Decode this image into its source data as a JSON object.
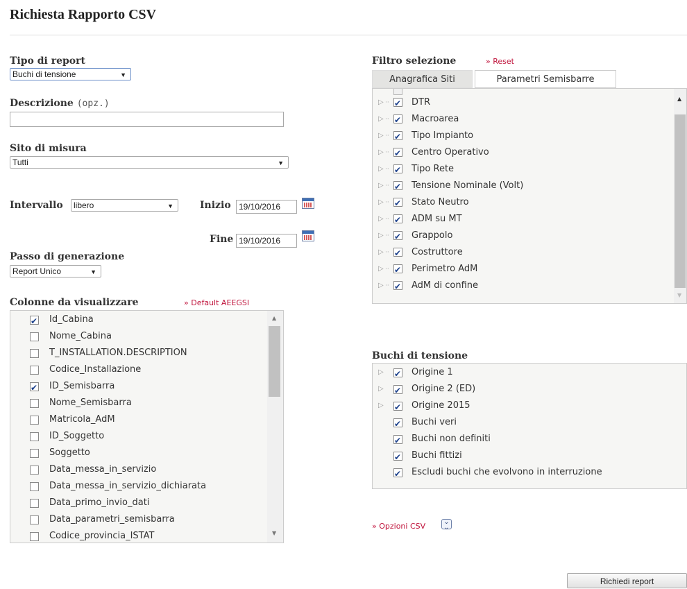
{
  "page": {
    "title": "Richiesta Rapporto CSV"
  },
  "form": {
    "tipo_report": {
      "label": "Tipo di report",
      "value": "Buchi di tensione"
    },
    "descrizione": {
      "label": "Descrizione",
      "optional": "(opz.)",
      "value": ""
    },
    "sito": {
      "label": "Sito di misura",
      "value": "Tutti"
    },
    "intervallo": {
      "label": "Intervallo",
      "value": "libero"
    },
    "inizio": {
      "label": "Inizio",
      "value": "19/10/2016"
    },
    "fine": {
      "label": "Fine",
      "value": "19/10/2016"
    },
    "passo": {
      "label": "Passo di generazione",
      "value": "Report Unico"
    }
  },
  "colonne": {
    "label": "Colonne da visualizzare",
    "default_link": "» Default AEEGSI",
    "items": [
      {
        "label": "Id_Cabina",
        "checked": true
      },
      {
        "label": "Nome_Cabina",
        "checked": false
      },
      {
        "label": "T_INSTALLATION.DESCRIPTION",
        "checked": false
      },
      {
        "label": "Codice_Installazione",
        "checked": false
      },
      {
        "label": "ID_Semisbarra",
        "checked": true
      },
      {
        "label": "Nome_Semisbarra",
        "checked": false
      },
      {
        "label": "Matricola_AdM",
        "checked": false
      },
      {
        "label": "ID_Soggetto",
        "checked": false
      },
      {
        "label": "Soggetto",
        "checked": false
      },
      {
        "label": "Data_messa_in_servizio",
        "checked": false
      },
      {
        "label": "Data_messa_in_servizio_dichiarata",
        "checked": false
      },
      {
        "label": "Data_primo_invio_dati",
        "checked": false
      },
      {
        "label": "Data_parametri_semisbarra",
        "checked": false
      },
      {
        "label": "Codice_provincia_ISTAT",
        "checked": false
      }
    ]
  },
  "filtro": {
    "label": "Filtro selezione",
    "reset_link": "» Reset",
    "tabs": [
      {
        "label": "Anagrafica Siti",
        "active": true
      },
      {
        "label": "Parametri Semisbarre",
        "active": false
      }
    ],
    "items": [
      {
        "label": "DTR",
        "checked": true
      },
      {
        "label": "Macroarea",
        "checked": true
      },
      {
        "label": "Tipo Impianto",
        "checked": true
      },
      {
        "label": "Centro Operativo",
        "checked": true
      },
      {
        "label": "Tipo Rete",
        "checked": true
      },
      {
        "label": "Tensione Nominale (Volt)",
        "checked": true
      },
      {
        "label": "Stato Neutro",
        "checked": true
      },
      {
        "label": "ADM su MT",
        "checked": true
      },
      {
        "label": "Grappolo",
        "checked": true
      },
      {
        "label": "Costruttore",
        "checked": true
      },
      {
        "label": "Perimetro AdM",
        "checked": true
      },
      {
        "label": "AdM di confine",
        "checked": true
      }
    ]
  },
  "buchi": {
    "label": "Buchi di tensione",
    "items": [
      {
        "label": "Origine 1",
        "checked": true,
        "expandable": true
      },
      {
        "label": "Origine 2 (ED)",
        "checked": true,
        "expandable": true
      },
      {
        "label": "Origine 2015",
        "checked": true,
        "expandable": true
      },
      {
        "label": "Buchi veri",
        "checked": true,
        "expandable": false
      },
      {
        "label": "Buchi non definiti",
        "checked": true,
        "expandable": false
      },
      {
        "label": "Buchi fittizi",
        "checked": true,
        "expandable": false
      },
      {
        "label": "Escludi buchi che evolvono in interruzione",
        "checked": true,
        "expandable": false
      }
    ]
  },
  "opzioni_csv": {
    "label": "» Opzioni CSV",
    "icon": "double-chevron-down-icon"
  },
  "submit": {
    "label": "Richiedi report"
  },
  "colors": {
    "accent_red": "#c0143c",
    "check_blue": "#1a3f8a"
  }
}
